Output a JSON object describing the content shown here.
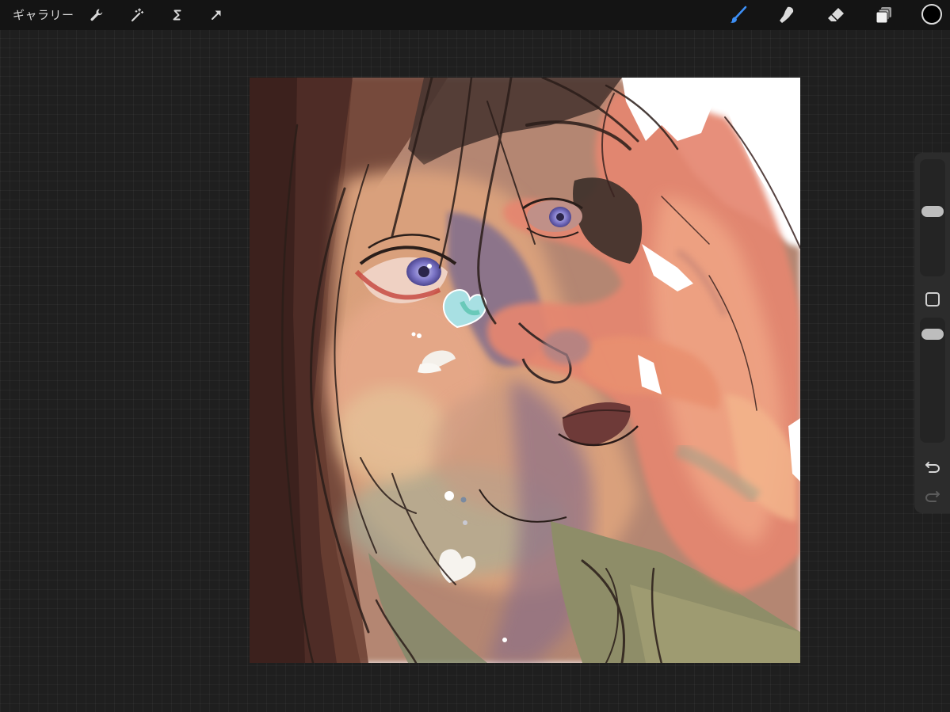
{
  "toolbar": {
    "gallery_label": "ギャラリー",
    "left_tools": [
      {
        "name": "actions",
        "icon": "wrench-icon"
      },
      {
        "name": "adjustments",
        "icon": "magic-wand-icon"
      },
      {
        "name": "selection",
        "icon": "selection-s-icon"
      },
      {
        "name": "transform",
        "icon": "arrow-cursor-icon"
      }
    ],
    "right_tools": [
      {
        "name": "brush",
        "icon": "brush-icon",
        "active": true
      },
      {
        "name": "smudge",
        "icon": "smudge-finger-icon",
        "active": false
      },
      {
        "name": "eraser",
        "icon": "eraser-icon",
        "active": false
      },
      {
        "name": "layers",
        "icon": "layers-icon",
        "active": false
      }
    ],
    "current_color": "#000000",
    "active_color": "#3d8ff5"
  },
  "sidebar": {
    "brush_size_icon": "slider-thumb",
    "modify_icon": "square-outline-icon",
    "opacity_icon": "slider-thumb",
    "undo_icon": "undo-arrow-icon",
    "redo_icon": "redo-arrow-icon"
  },
  "canvas": {
    "content": "digital-painting-portrait",
    "background": "#ffffff"
  }
}
